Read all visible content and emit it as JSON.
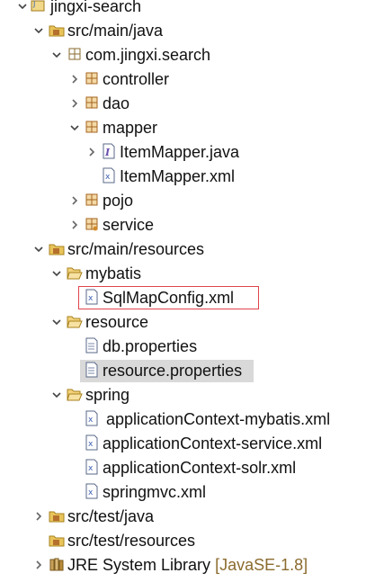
{
  "tree": {
    "project": {
      "label": "jingxi-search"
    },
    "src_main_java": {
      "label": "src/main/java"
    },
    "package": {
      "label": "com.jingxi.search"
    },
    "controller": {
      "label": "controller"
    },
    "dao": {
      "label": "dao"
    },
    "mapper": {
      "label": "mapper"
    },
    "item_mapper_java": {
      "label": "ItemMapper.java"
    },
    "item_mapper_xml": {
      "label": "ItemMapper.xml"
    },
    "pojo": {
      "label": "pojo"
    },
    "service": {
      "label": "service"
    },
    "src_main_resources": {
      "label": "src/main/resources"
    },
    "mybatis": {
      "label": "mybatis"
    },
    "sqlmapconfig": {
      "label": "SqlMapConfig.xml"
    },
    "resource": {
      "label": "resource"
    },
    "db_properties": {
      "label": "db.properties"
    },
    "resource_properties": {
      "label": "resource.properties"
    },
    "spring": {
      "label": "spring"
    },
    "ctx_mybatis": {
      "label": "applicationContext-mybatis.xml"
    },
    "ctx_service": {
      "label": "applicationContext-service.xml"
    },
    "ctx_solr": {
      "label": "applicationContext-solr.xml"
    },
    "springmvc": {
      "label": "springmvc.xml"
    },
    "src_test_java": {
      "label": "src/test/java"
    },
    "src_test_resources": {
      "label": "src/test/resources"
    },
    "jre": {
      "label": "JRE System Library",
      "qualifier": "[JavaSE-1.8]"
    }
  },
  "colors": {
    "highlight_bg": "#d9d9d9",
    "selection_border": "#e0444a",
    "library_qualifier": "#8b6b2e"
  }
}
